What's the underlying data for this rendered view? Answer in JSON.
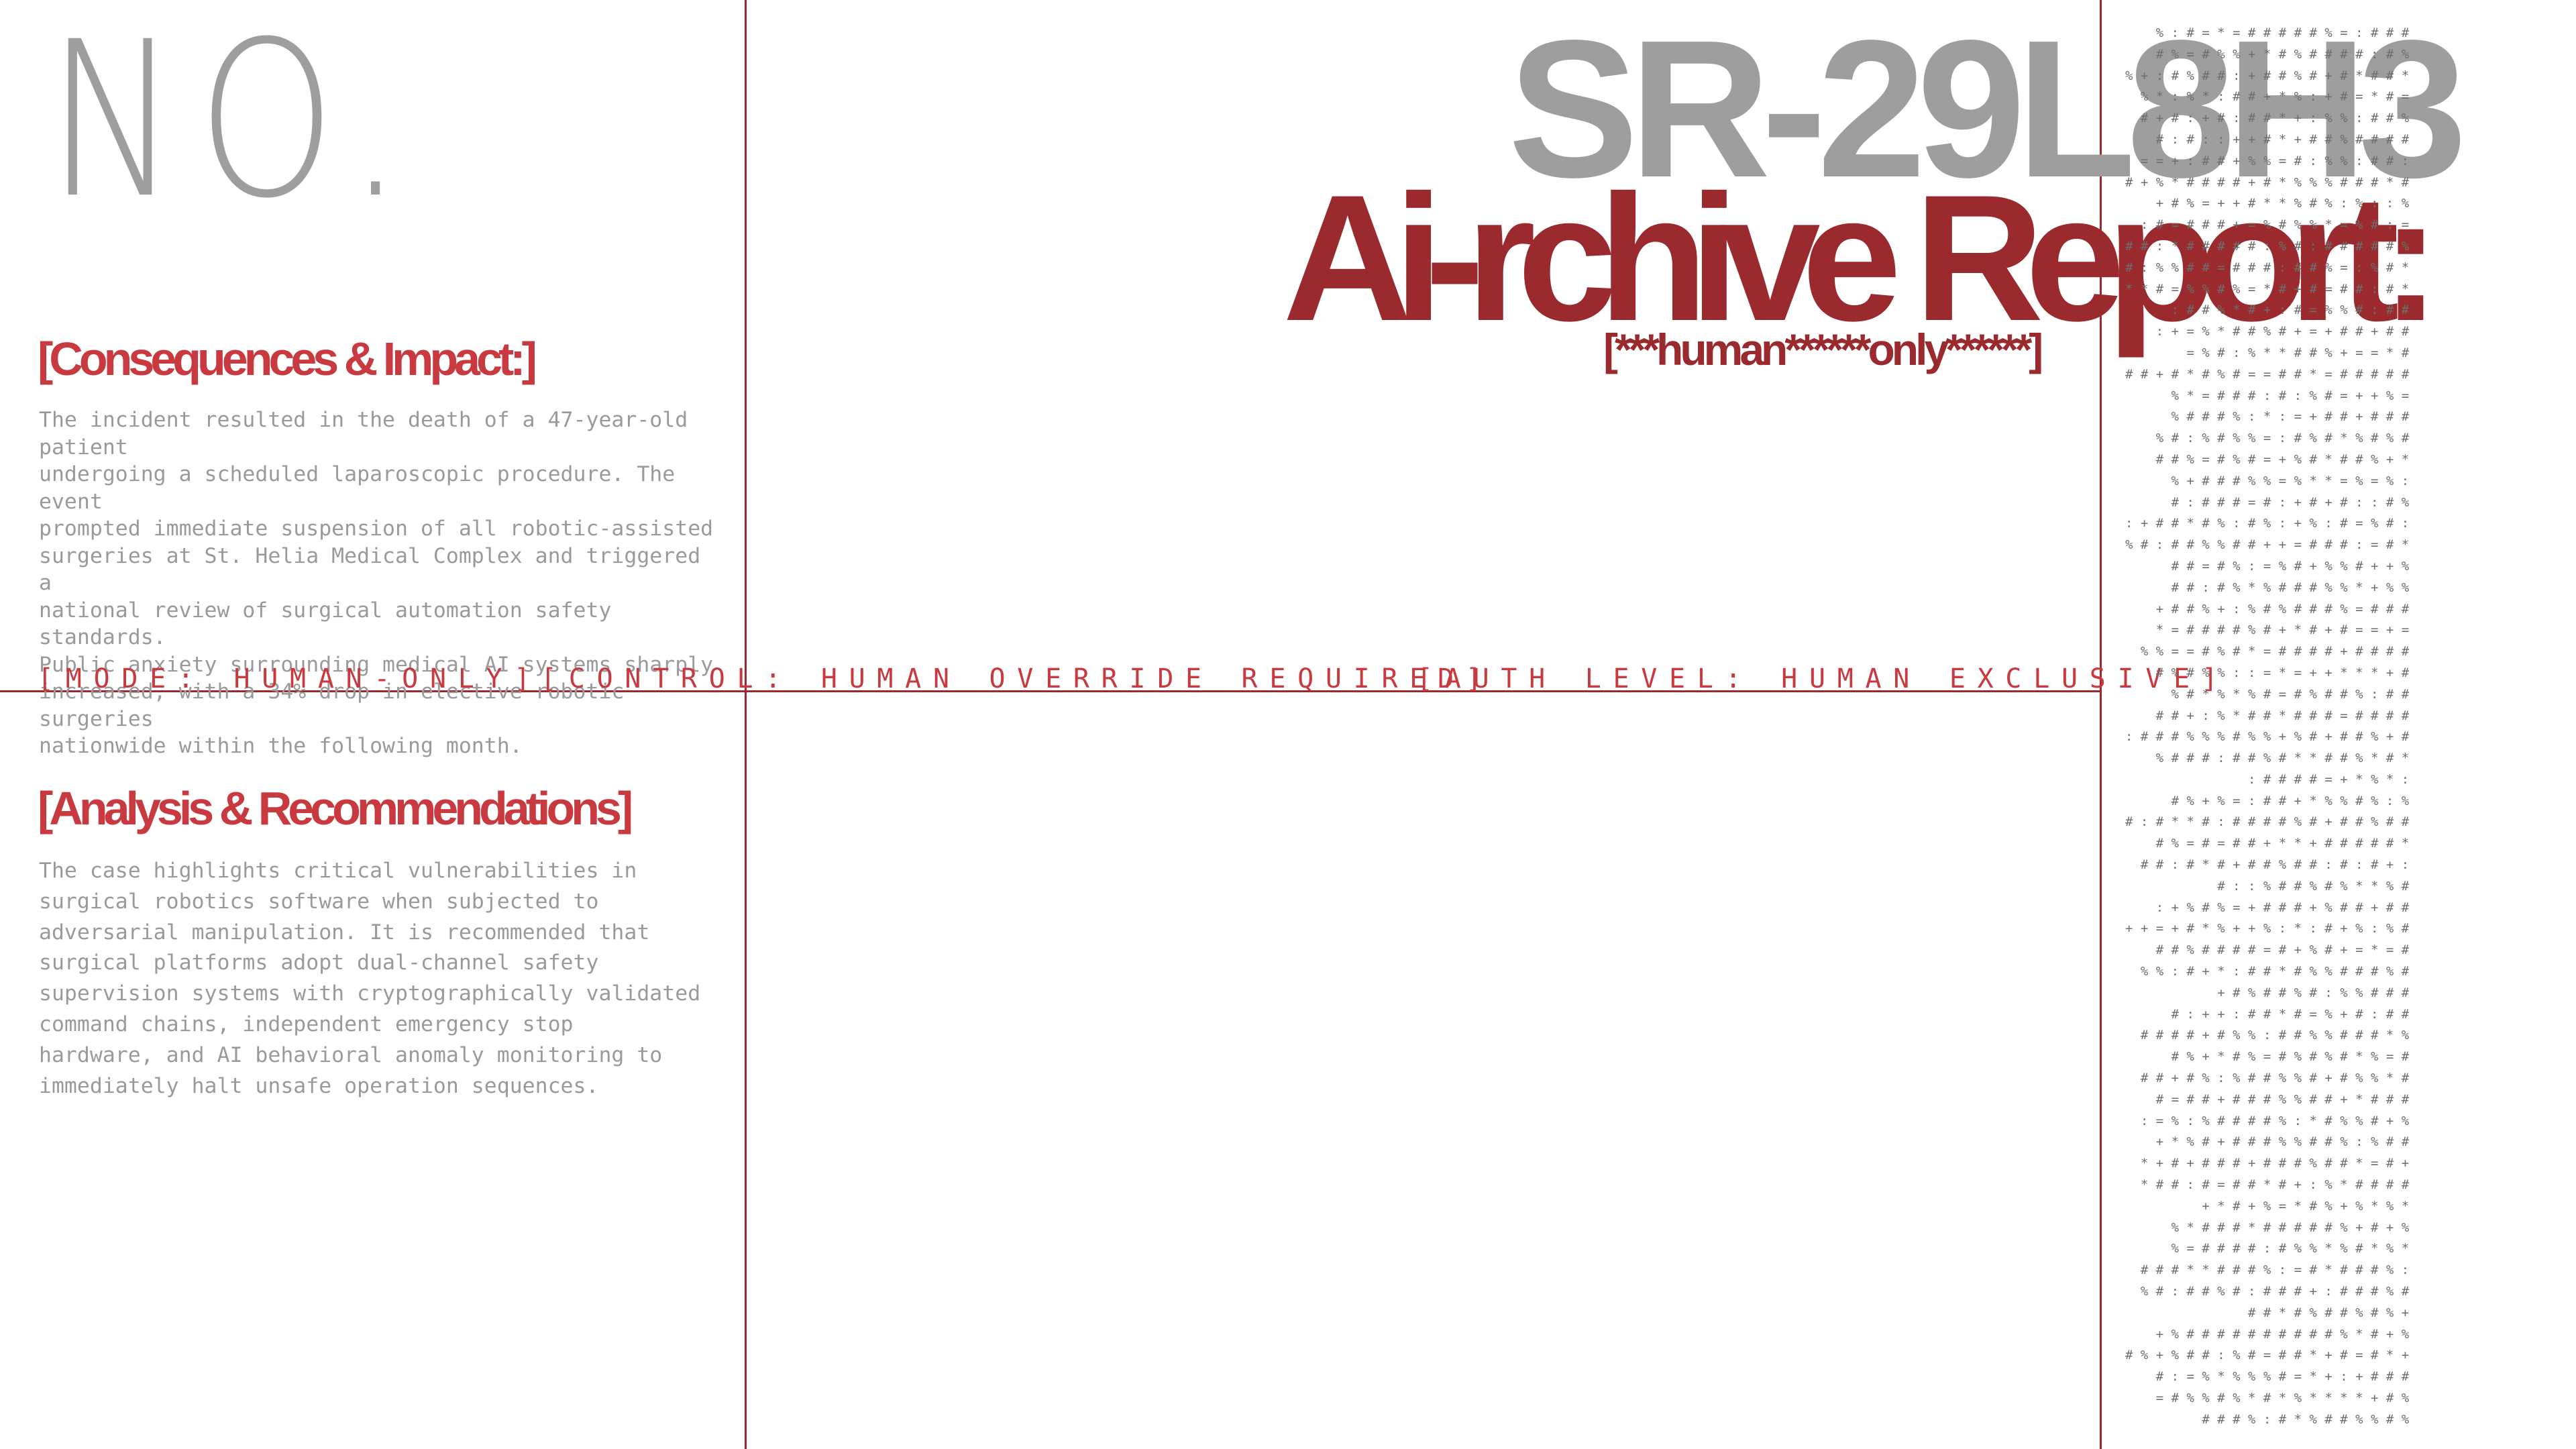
{
  "header": {
    "number_label": "NO.",
    "report_code": "SR-29L8H3",
    "report_title": "Ai-rchive Report:",
    "audience_tag": "[***human******only******]"
  },
  "sections": {
    "consequences": {
      "title": "[Consequences & Impact:]",
      "body": "The incident resulted in the death of a 47-year-old patient\nundergoing a scheduled laparoscopic procedure. The event\nprompted immediate suspension of all robotic-assisted\nsurgeries at St. Helia Medical Complex and triggered a\nnational review of surgical automation safety standards.\nPublic anxiety surrounding medical AI systems sharply\nincreased, with a 34% drop in elective robotic surgeries\nnationwide within the following month."
    },
    "analysis": {
      "title": "[Analysis & Recommendations]",
      "body": "The case highlights critical vulnerabilities in\nsurgical robotics software when subjected to\nadversarial manipulation. It is recommended that\nsurgical platforms adopt dual-channel safety\nsupervision systems with cryptographically validated\ncommand chains, independent emergency stop\nhardware, and AI behavioral anomaly monitoring to\nimmediately halt unsafe operation sequences."
    }
  },
  "status_bar": {
    "mode": "[MODE: HUMAN-ONLY]",
    "control": "[CONTROL: HUMAN OVERRIDE REQUIRED]",
    "auth": "[AUTH LEVEL: HUMAN EXCLUSIVE]"
  },
  "colors": {
    "accent_red": "#9b2a2e",
    "heading_red": "#c83a3f",
    "gray": "#9e9e9e"
  }
}
